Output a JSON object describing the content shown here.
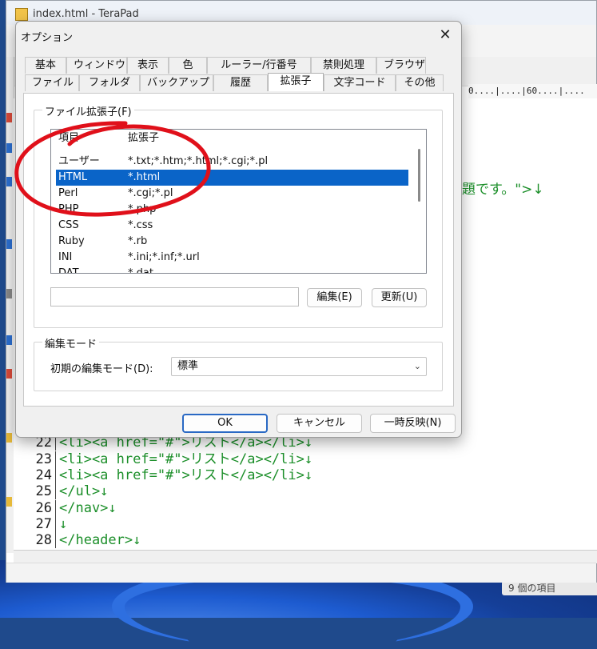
{
  "window": {
    "title": "index.html - TeraPad",
    "ruler_text": "0....|....|60....|...."
  },
  "editor": {
    "partial_line_text": "題です。\">↓",
    "lines": [
      {
        "num": "22",
        "text": "<li><a href=\"#\">リスト</a></li>↓"
      },
      {
        "num": "23",
        "text": "<li><a href=\"#\">リスト</a></li>↓"
      },
      {
        "num": "24",
        "text": "<li><a href=\"#\">リスト</a></li>↓"
      },
      {
        "num": "25",
        "text": "</ul>↓"
      },
      {
        "num": "26",
        "text": "</nav>↓"
      },
      {
        "num": "27",
        "text": "↓"
      },
      {
        "num": "28",
        "text": "</header>↓"
      }
    ]
  },
  "taskbar": {
    "item_label": "9 個の項目"
  },
  "dialog": {
    "title": "オプション",
    "close_label": "✕",
    "tabs_row1": [
      "基本",
      "ウィンドウ",
      "表示",
      "色",
      "ルーラー/行番号",
      "禁則処理",
      "ブラウザ"
    ],
    "tabs_row2": [
      "ファイル",
      "フォルダ",
      "バックアップ",
      "履歴",
      "拡張子",
      "文字コード",
      "その他"
    ],
    "active_tab": "拡張子",
    "extension_group": {
      "label": "ファイル拡張子(F)",
      "columns": {
        "name": "項目",
        "ext": "拡張子"
      },
      "rows": [
        {
          "name": "ユーザー",
          "ext": "*.txt;*.htm;*.html;*.cgi;*.pl"
        },
        {
          "name": "HTML",
          "ext": "*.html"
        },
        {
          "name": "Perl",
          "ext": "*.cgi;*.pl"
        },
        {
          "name": "PHP",
          "ext": "*.php"
        },
        {
          "name": "CSS",
          "ext": "*.css"
        },
        {
          "name": "Ruby",
          "ext": "*.rb"
        },
        {
          "name": "INI",
          "ext": "*.ini;*.inf;*.url"
        },
        {
          "name": "DAT",
          "ext": "*.dat"
        }
      ],
      "selected_row": "HTML",
      "edit_field_value": "",
      "edit_button": "編集(E)",
      "update_button": "更新(U)"
    },
    "mode_group": {
      "label": "編集モード",
      "field_label": "初期の編集モード(D):",
      "selected_value": "標準"
    },
    "buttons": {
      "ok": "OK",
      "cancel": "キャンセル",
      "apply": "一時反映(N)"
    }
  },
  "colors": {
    "code_green": "#1c8f2a",
    "selection_blue": "#0a64c8",
    "annotation_red": "#e0101a"
  }
}
